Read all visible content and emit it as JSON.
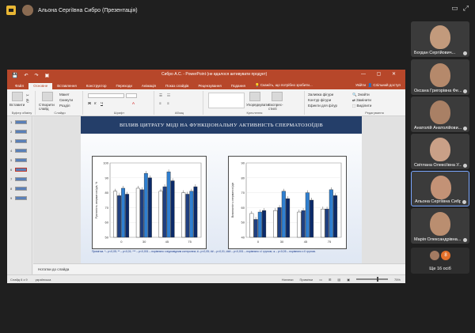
{
  "meeting": {
    "presenter_label": "Альона Сергіївна Сибро (Презентація)"
  },
  "powerpoint": {
    "doc_title": "Сибро А.С. - PowerPoint (не вдалося активувати продукт)",
    "tabs": [
      "Файл",
      "Основне",
      "Вставлення",
      "Конструктор",
      "Переходи",
      "Анімація",
      "Показ слайдів",
      "Рецензування",
      "Подання"
    ],
    "active_tab": "Основне",
    "tell_me": "Скажіть, що потрібно зробити...",
    "account": "Увійти",
    "share": "Спільний доступ",
    "ribbon": {
      "paste": "Вставити",
      "new_slide": "Створити слайд",
      "layout": "Макет",
      "reset": "Скинути",
      "section": "Розділ",
      "clipboard": "Буфер обміну",
      "slides": "Слайди",
      "font": "Шрифт",
      "paragraph": "Абзац",
      "drawing": "Креслення",
      "arrange": "Упорядкувати",
      "quick_styles": "Експрес-стилі",
      "shape_fill": "Заливка фігури",
      "shape_outline": "Контур фігури",
      "shape_effects": "Ефекти для фігур",
      "find": "Знайти",
      "replace": "Замінити",
      "select": "Виділити",
      "editing": "Редагування"
    },
    "thumbnails": [
      "1",
      "2",
      "3",
      "4",
      "5",
      "6",
      "7",
      "8",
      "9"
    ],
    "selected_thumb": "6",
    "notes_placeholder": "Нотатки до слайда",
    "status": {
      "slide": "Слайд 6 з 9",
      "language": "українська",
      "notes": "Нотатки",
      "comments": "Примітки",
      "zoom": "75%"
    }
  },
  "slide": {
    "title": "ВПЛИВ ЦИТРАТУ МІДІ НА ФУНКЦІОНАЛЬНУ АКТИВНІСТЬ СПЕРМАТОЗОЇДІВ",
    "note": "Примітка. *– р<0,05; ** – р<0,01; *** – р<0,001 – порівняно з відповідним контролем; #– р<0,05; ## – р<0,01; ### – р<0,001 – порівняно з І групою; ● – р<0,05 – порівняно з ІІ групою."
  },
  "chart_data": [
    {
      "type": "bar",
      "title": "",
      "xlabel": "",
      "ylabel": "Рухливість сперматозоїдів, %",
      "categories": [
        "0",
        "30",
        "45",
        "75"
      ],
      "ylim": [
        50,
        100
      ],
      "series": [
        {
          "values": [
            81,
            83,
            81,
            80
          ]
        },
        {
          "values": [
            78,
            82,
            84,
            79
          ]
        },
        {
          "values": [
            83,
            93,
            94,
            81
          ]
        },
        {
          "values": [
            79,
            90,
            88,
            84
          ]
        }
      ],
      "colors": [
        "#ffffff",
        "#1f3f80",
        "#2f7fd0",
        "#0a2a6a"
      ]
    },
    {
      "type": "bar",
      "title": "",
      "xlabel": "",
      "ylabel": "Виживаність сперматозоїдів",
      "categories": [
        "0",
        "30",
        "45",
        "75"
      ],
      "ylim": [
        40,
        90
      ],
      "series": [
        {
          "values": [
            56,
            58,
            57,
            59
          ]
        },
        {
          "values": [
            52,
            60,
            58,
            59
          ]
        },
        {
          "values": [
            57,
            71,
            70,
            72
          ]
        },
        {
          "values": [
            58,
            66,
            65,
            68
          ]
        }
      ],
      "colors": [
        "#ffffff",
        "#1f3f80",
        "#2f7fd0",
        "#0a2a6a"
      ]
    }
  ],
  "participants": [
    {
      "name": "Богдан Сергійович...",
      "skin": "#c29a7c"
    },
    {
      "name": "Оксана Григорівна Фе...",
      "skin": "#b5896b"
    },
    {
      "name": "Анатолій Анатолійови...",
      "skin": "#a98065"
    },
    {
      "name": "Світлана Олексіївна У...",
      "skin": "#c9a087"
    },
    {
      "name": "Альона Сергіївна Сибро",
      "skin": "#c39276"
    },
    {
      "name": "Марія Олександрівна...",
      "skin": "#ba8e70"
    }
  ],
  "more": {
    "count": "8",
    "label": "Ще 16 осіб"
  }
}
